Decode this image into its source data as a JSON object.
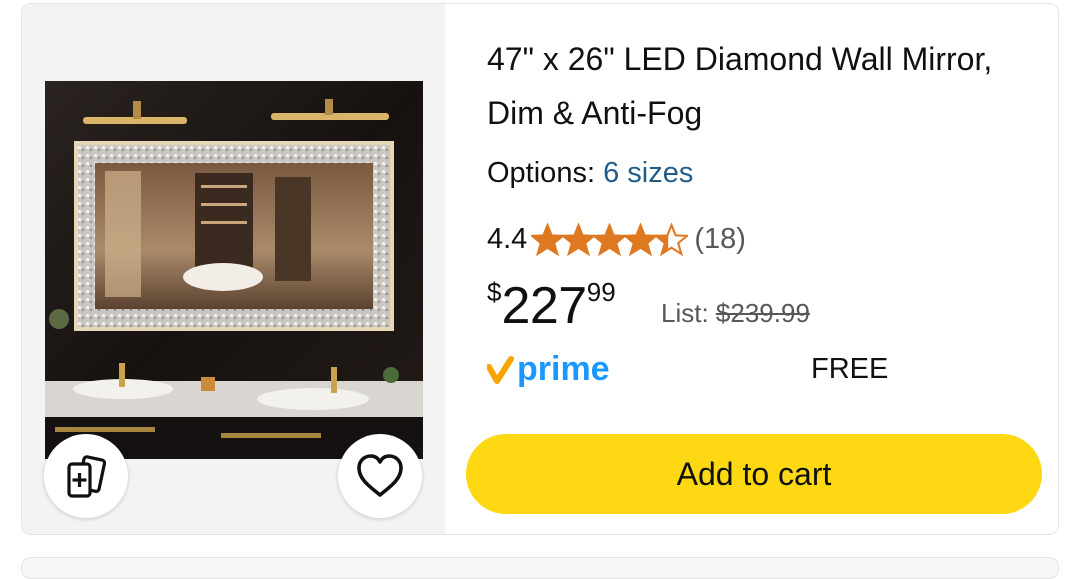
{
  "product": {
    "title": "47\" x 26\" LED Diamond Wall Mirror, Dim & Anti-Fog",
    "options_label": "Options:",
    "options_value": "6 sizes",
    "rating": "4.4",
    "rating_stars": 4.4,
    "review_count": "(18)",
    "price_symbol": "$",
    "price_whole": "227",
    "price_fraction": "99",
    "list_label": "List:",
    "list_price": "$239.99",
    "prime_label": "prime",
    "shipping": "FREE",
    "add_to_cart": "Add to cart",
    "image_icon": "led-mirror-product-photo"
  },
  "actions": {
    "compare_icon": "add-to-compare-icon",
    "wishlist_icon": "heart-icon"
  },
  "colors": {
    "star": "#de7921",
    "link": "#1f5c8a",
    "prime_blue": "#1a98ff",
    "prime_check": "#f7a300",
    "button": "#ffd814"
  }
}
